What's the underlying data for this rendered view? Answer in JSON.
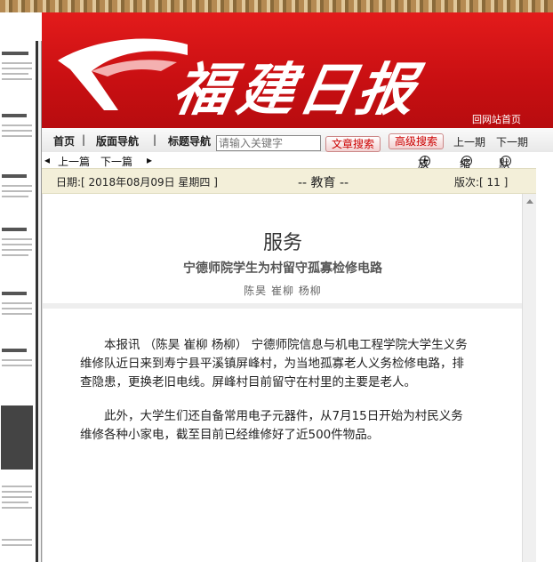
{
  "masthead": {
    "title_chars": [
      "福",
      "建",
      "日",
      "报"
    ],
    "home_link": "回网站首页"
  },
  "nav": {
    "home": "首页",
    "sep1": "|",
    "layout_nav": "版面导航",
    "sep2": "|",
    "title_nav": "标题导航",
    "search_placeholder": "请输入关键字",
    "search_btn": "文章搜索",
    "advanced_btn": "高级搜索",
    "prev_issue": "上一期",
    "next_issue": "下一期"
  },
  "subnav": {
    "prev_article": "上一篇",
    "next_article": "下一篇",
    "zoom_in": "放大",
    "zoom_out": "缩小",
    "default": "默认"
  },
  "datebar": {
    "date": "日期:[ 2018年08月09日 星期四 ]",
    "section": "-- 教育 --",
    "page": "版次:[ 11 ]"
  },
  "article": {
    "section": "服务",
    "title": "宁德师院学生为村留守孤寡检修电路",
    "authors": "陈昊 崔柳 杨柳",
    "paragraphs": [
      "本报讯 （陈昊 崔柳 杨柳） 宁德师院信息与机电工程学院大学生义务维修队近日来到寿宁县平溪镇屏峰村，为当地孤寡老人义务检修电路，排查隐患，更换老旧电线。屏峰村目前留守在村里的主要是老人。",
      "此外，大学生们还自备常用电子元器件，从7月15日开始为村民义务维修各种小家电，截至目前已经维修好了近500件物品。"
    ]
  },
  "colors": {
    "banner_red": "#d5141a",
    "date_bar": "#f3efd9",
    "button_text": "#cc0000"
  }
}
